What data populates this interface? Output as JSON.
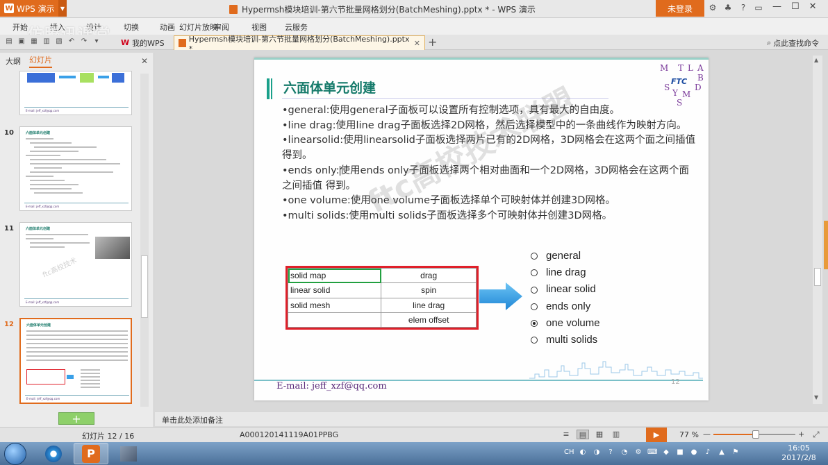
{
  "titlebar": {
    "app_name": "WPS 演示",
    "doc_title": "Hypermsh模块培训-第六节批量网格划分(BatchMeshing).pptx * - WPS 演示",
    "login_label": "未登录"
  },
  "menu": {
    "items": [
      "开始",
      "插入",
      "设计",
      "切换",
      "动画",
      "幻灯片放映",
      "审阅",
      "视图",
      "云服务"
    ],
    "watermark": "仿腾讯课堂"
  },
  "tabs": {
    "mywps_label": "我的WPS",
    "active_label": "Hypermsh模块培训-第六节批量网格划分(BatchMeshing).pptx *",
    "search_label": "点此查找命令"
  },
  "leftpanel": {
    "tab_outline": "大纲",
    "tab_slides": "幻灯片",
    "thumbs": [
      {
        "num": "10",
        "title": "六面体单元创建"
      },
      {
        "num": "11",
        "title": "六面体单元创建"
      },
      {
        "num": "12",
        "title": "六面体单元创建"
      }
    ],
    "thumb_email": "E-mail: jeff_xzf@qq.com"
  },
  "slide": {
    "title": "六面体单元创建",
    "bullets": [
      "•general:使用general子面板可以设置所有控制选项，具有最大的自由度。",
      "•line drag:使用line drag子面板选择2D网格，然后选择模型中的一条曲线作为映射方向。",
      "•linearsolid:使用linearsolid子面板选择两片已有的2D网格，3D网格会在这两个面之间插值得到。",
      "•ends only:",
      "使用ends only子面板选择两个相对曲面和一个2D网格，3D网格会在这两个面之间插值 得到。",
      "•one volume:使用one volume子面板选择单个可映射体并创建3D网格。",
      "•multi solids:使用multi solids子面板选择多个可映射体并创建3D网格。"
    ],
    "logo_letters": [
      "M",
      "T",
      "L",
      "A",
      "B",
      "D",
      "S",
      "Y",
      "M",
      "S"
    ],
    "logo_badge": "FTC",
    "watermark": "ftc高校技术联盟",
    "table": [
      [
        "solid map",
        "drag"
      ],
      [
        "linear solid",
        "spin"
      ],
      [
        "solid mesh",
        "line drag"
      ],
      [
        "",
        "elem offset"
      ]
    ],
    "radio_options": [
      "general",
      "line drag",
      "linear solid",
      "ends only",
      "one volume",
      "multi solids"
    ],
    "radio_selected": "one volume",
    "email": "E-mail: jeff_xzf@qq.com",
    "page_num": "12"
  },
  "notes": {
    "placeholder": "单击此处添加备注"
  },
  "status": {
    "slide_count": "幻灯片 12 / 16",
    "doc_id": "A000120141119A01PPBG",
    "zoom_label": "77 %",
    "zoom_level": 0.52
  },
  "taskbar": {
    "tray_lang": "CH",
    "time": "16:05",
    "date": "2017/2/8"
  },
  "colors": {
    "accent": "#e06b1d",
    "title_teal": "#157a6a",
    "table_border": "#e0202a",
    "arrow": "#3aa0e8"
  }
}
